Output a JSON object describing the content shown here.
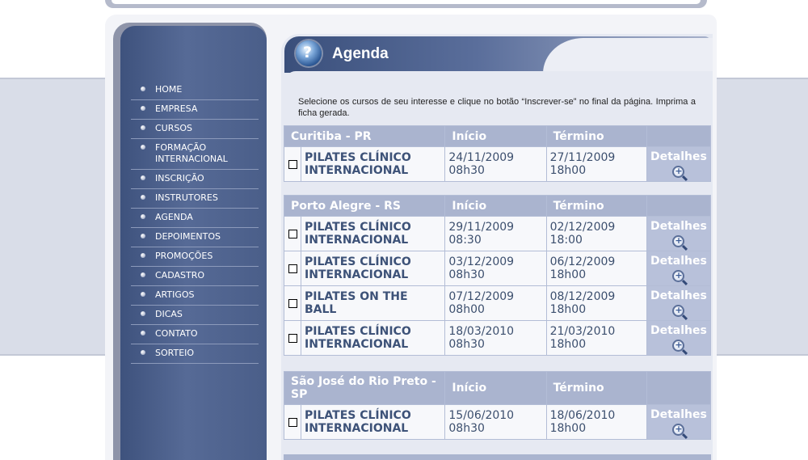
{
  "menu": [
    {
      "label": "HOME"
    },
    {
      "label": "EMPRESA"
    },
    {
      "label": "CURSOS"
    },
    {
      "label": "FORMAÇÃO INTERNACIONAL"
    },
    {
      "label": "INSCRIÇÃO"
    },
    {
      "label": "INSTRUTORES"
    },
    {
      "label": "AGENDA"
    },
    {
      "label": "DEPOIMENTOS"
    },
    {
      "label": "PROMOÇÕES"
    },
    {
      "label": "CADASTRO"
    },
    {
      "label": "ARTIGOS"
    },
    {
      "label": "DICAS"
    },
    {
      "label": "CONTATO"
    },
    {
      "label": "SORTEIO"
    }
  ],
  "page": {
    "title": "Agenda",
    "intro": "Selecione os cursos de seu interesse e clique no botão “Inscrever-se” no final da página. Imprima a ficha gerada."
  },
  "columns": {
    "start": "Início",
    "end": "Término"
  },
  "details_label": "Detalhes",
  "cities": [
    {
      "name": "Curitiba - PR",
      "courses": [
        {
          "name": "PILATES CLÍNICO INTERNACIONAL",
          "start": "24/11/2009 08h30",
          "end": "27/11/2009 18h00"
        }
      ]
    },
    {
      "name": "Porto Alegre - RS",
      "courses": [
        {
          "name": "PILATES CLÍNICO INTERNACIONAL",
          "start": "29/11/2009 08:30",
          "end": "02/12/2009 18:00"
        },
        {
          "name": "PILATES CLÍNICO INTERNACIONAL",
          "start": "03/12/2009 08h30",
          "end": "06/12/2009 18h00"
        },
        {
          "name": "PILATES ON THE BALL",
          "start": "07/12/2009 08h00",
          "end": "08/12/2009 18h00"
        },
        {
          "name": "PILATES CLÍNICO INTERNACIONAL",
          "start": "18/03/2010 08h30",
          "end": "21/03/2010 18h00"
        }
      ]
    },
    {
      "name": "São José do Rio Preto - SP",
      "courses": [
        {
          "name": "PILATES CLÍNICO INTERNACIONAL",
          "start": "15/06/2010 08h30",
          "end": "18/06/2010 18h00"
        }
      ]
    }
  ]
}
